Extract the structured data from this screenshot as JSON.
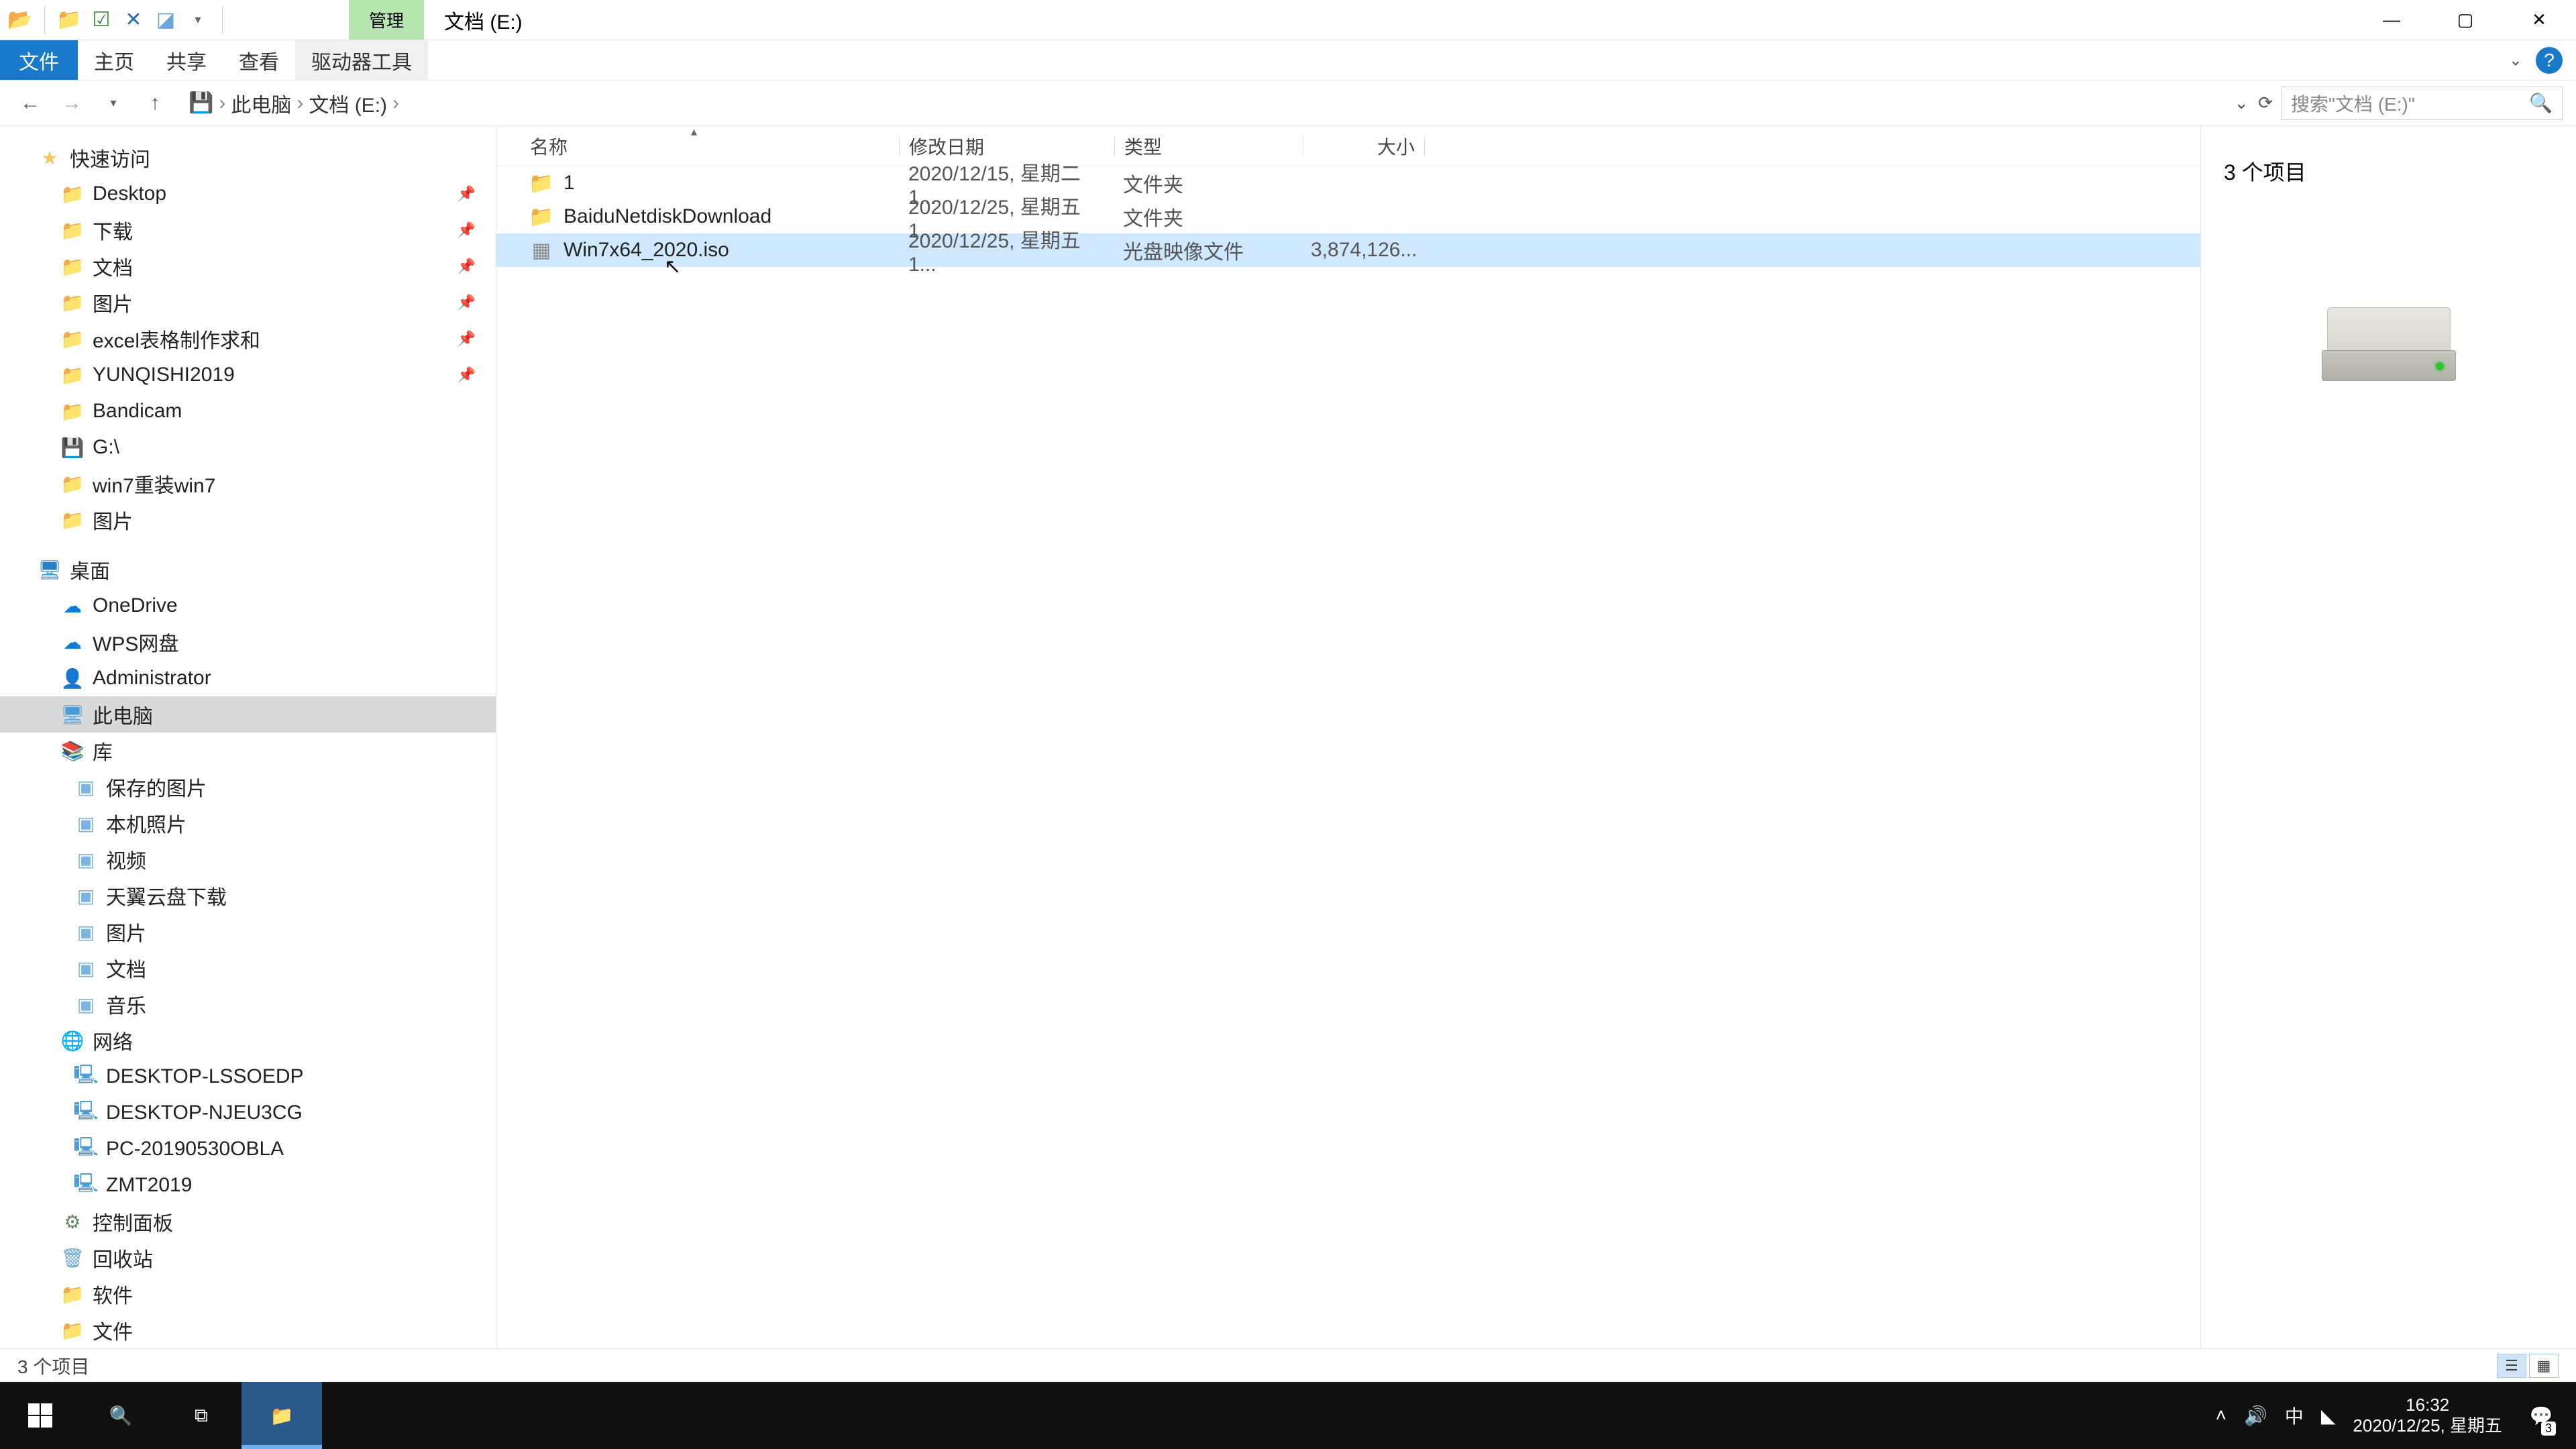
{
  "titlebar": {
    "qat": [
      "open-icon",
      "folder-icon",
      "checkbox-icon",
      "close-icon",
      "new-icon"
    ],
    "manage_tab": "管理",
    "title": "文档 (E:)"
  },
  "ribbon": {
    "file": "文件",
    "home": "主页",
    "share": "共享",
    "view": "查看",
    "drive_tools": "驱动器工具"
  },
  "address": {
    "root": "此电脑",
    "location": "文档 (E:)",
    "search_placeholder": "搜索\"文档 (E:)\""
  },
  "tree": {
    "quick_access": "快速访问",
    "quick_items": [
      {
        "label": "Desktop",
        "icon": "folder",
        "pin": true
      },
      {
        "label": "下载",
        "icon": "folder",
        "pin": true
      },
      {
        "label": "文档",
        "icon": "folder",
        "pin": true
      },
      {
        "label": "图片",
        "icon": "folder",
        "pin": true
      },
      {
        "label": "excel表格制作求和",
        "icon": "folder",
        "pin": true
      },
      {
        "label": "YUNQISHI2019",
        "icon": "folder",
        "pin": true
      },
      {
        "label": "Bandicam",
        "icon": "folder",
        "pin": false
      },
      {
        "label": "G:\\",
        "icon": "drive",
        "pin": false
      },
      {
        "label": "win7重装win7",
        "icon": "folder",
        "pin": false
      },
      {
        "label": "图片",
        "icon": "folder",
        "pin": false
      }
    ],
    "desktop": "桌面",
    "desktop_items": [
      {
        "label": "OneDrive",
        "icon": "cloud"
      },
      {
        "label": "WPS网盘",
        "icon": "cloud"
      },
      {
        "label": "Administrator",
        "icon": "user"
      },
      {
        "label": "此电脑",
        "icon": "pc",
        "selected": true
      },
      {
        "label": "库",
        "icon": "lib"
      }
    ],
    "library_items": [
      {
        "label": "保存的图片"
      },
      {
        "label": "本机照片"
      },
      {
        "label": "视频"
      },
      {
        "label": "天翼云盘下载"
      },
      {
        "label": "图片"
      },
      {
        "label": "文档"
      },
      {
        "label": "音乐"
      }
    ],
    "network": "网络",
    "network_items": [
      {
        "label": "DESKTOP-LSSOEDP"
      },
      {
        "label": "DESKTOP-NJEU3CG"
      },
      {
        "label": "PC-20190530OBLA"
      },
      {
        "label": "ZMT2019"
      }
    ],
    "others": [
      {
        "label": "控制面板",
        "icon": "panel"
      },
      {
        "label": "回收站",
        "icon": "bin"
      },
      {
        "label": "软件",
        "icon": "folder"
      },
      {
        "label": "文件",
        "icon": "folder"
      }
    ]
  },
  "columns": {
    "name": "名称",
    "date": "修改日期",
    "type": "类型",
    "size": "大小"
  },
  "files": [
    {
      "name": "1",
      "date": "2020/12/15, 星期二 1...",
      "type": "文件夹",
      "size": "",
      "icon": "folder"
    },
    {
      "name": "BaiduNetdiskDownload",
      "date": "2020/12/25, 星期五 1...",
      "type": "文件夹",
      "size": "",
      "icon": "folder"
    },
    {
      "name": "Win7x64_2020.iso",
      "date": "2020/12/25, 星期五 1...",
      "type": "光盘映像文件",
      "size": "3,874,126...",
      "icon": "iso",
      "selected": true
    }
  ],
  "preview": {
    "title": "3 个项目"
  },
  "statusbar": {
    "count": "3 个项目"
  },
  "taskbar": {
    "time": "16:32",
    "date": "2020/12/25, 星期五",
    "ime": "中",
    "notifications": "3"
  }
}
